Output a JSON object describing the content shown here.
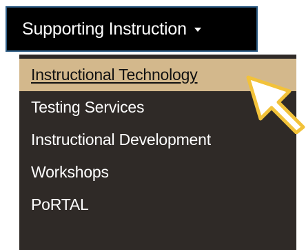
{
  "nav": {
    "toggle_label": "Supporting Instruction",
    "menu": {
      "items": [
        {
          "label": "Instructional Technology",
          "active": true
        },
        {
          "label": "Testing Services"
        },
        {
          "label": "Instructional Development"
        },
        {
          "label": "Workshops"
        },
        {
          "label": "PoRTAL"
        }
      ]
    }
  },
  "colors": {
    "toggle_bg": "#000000",
    "toggle_border": "#2e5d86",
    "menu_bg": "#2f2a27",
    "active_bg": "#d3b88c",
    "pointer_stroke": "#f2c23a"
  },
  "icons": {
    "caret": "caret-down-icon",
    "pointer": "pointer-arrow-icon"
  }
}
